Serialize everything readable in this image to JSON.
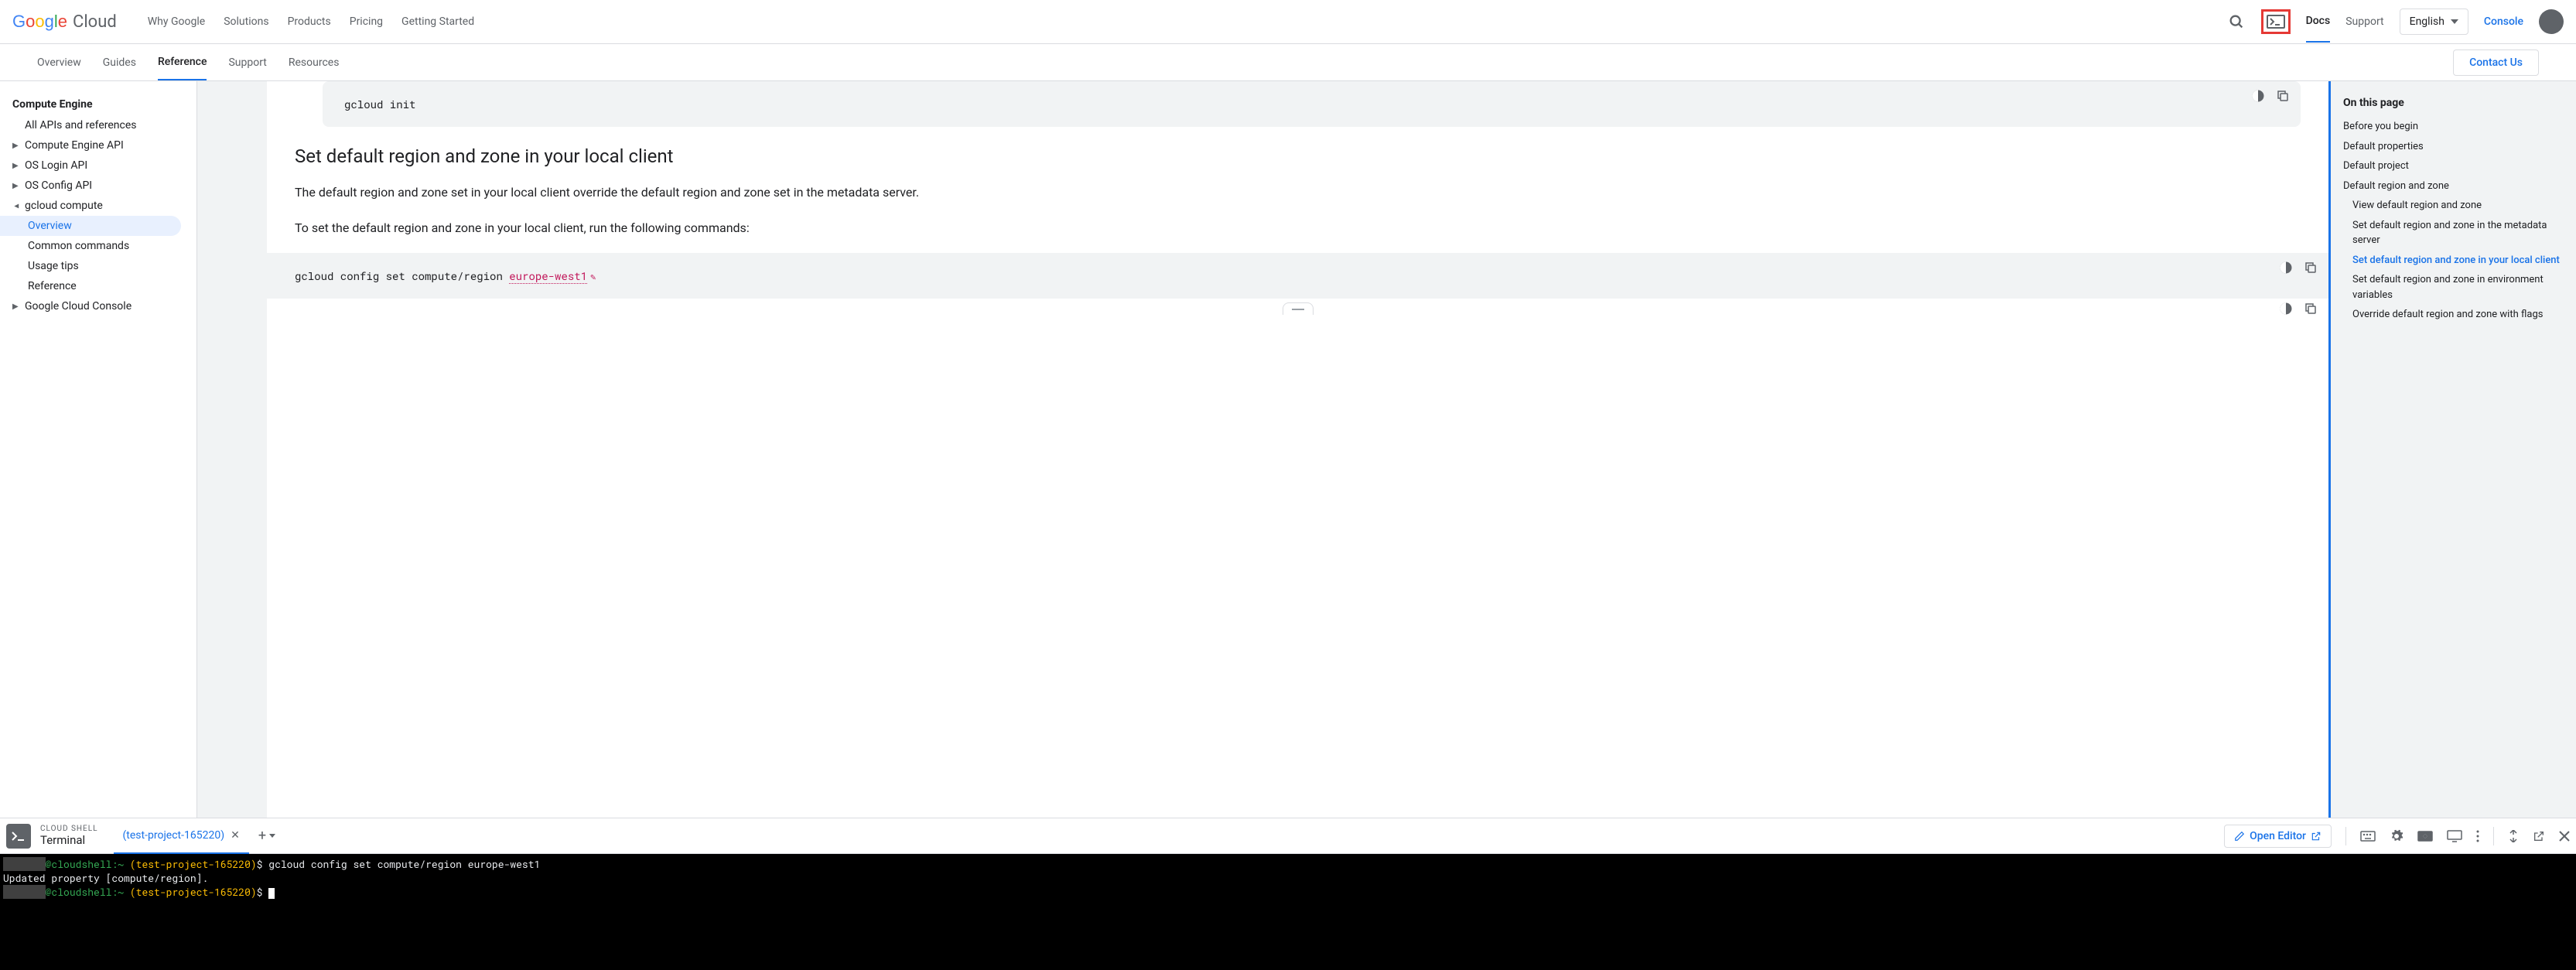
{
  "header": {
    "logo_suffix": "Cloud",
    "nav": [
      "Why Google",
      "Solutions",
      "Products",
      "Pricing",
      "Getting Started"
    ],
    "docs": "Docs",
    "support": "Support",
    "language": "English",
    "console": "Console"
  },
  "subnav": {
    "items": [
      "Overview",
      "Guides",
      "Reference",
      "Support",
      "Resources"
    ],
    "active_index": 2,
    "contact": "Contact Us"
  },
  "sidebar": {
    "heading": "Compute Engine",
    "items": [
      {
        "label": "All APIs and references",
        "indent": 1,
        "arrow": false
      },
      {
        "label": "Compute Engine API",
        "indent": 1,
        "arrow": true
      },
      {
        "label": "OS Login API",
        "indent": 1,
        "arrow": true
      },
      {
        "label": "OS Config API",
        "indent": 1,
        "arrow": true
      },
      {
        "label": "gcloud compute",
        "indent": 1,
        "arrow": true,
        "expanded": true
      },
      {
        "label": "Overview",
        "indent": 2,
        "arrow": false,
        "active": true
      },
      {
        "label": "Common commands",
        "indent": 2,
        "arrow": false
      },
      {
        "label": "Usage tips",
        "indent": 2,
        "arrow": false
      },
      {
        "label": "Reference",
        "indent": 2,
        "arrow": false
      },
      {
        "label": "Google Cloud Console",
        "indent": 1,
        "arrow": true
      }
    ]
  },
  "content": {
    "code1": "gcloud init",
    "heading": "Set default region and zone in your local client",
    "para1": "The default region and zone set in your local client override the default region and zone set in the metadata server.",
    "para2": "To set the default region and zone in your local client, run the following commands:",
    "code2_prefix": "gcloud config set compute/region ",
    "code2_var": "europe-west1"
  },
  "toc": {
    "heading": "On this page",
    "items": [
      {
        "label": "Before you begin"
      },
      {
        "label": "Default properties"
      },
      {
        "label": "Default project"
      },
      {
        "label": "Default region and zone"
      },
      {
        "label": "View default region and zone",
        "indent": true
      },
      {
        "label": "Set default region and zone in the metadata server",
        "indent": true
      },
      {
        "label": "Set default region and zone in your local client",
        "indent": true,
        "active": true
      },
      {
        "label": "Set default region and zone in environment variables",
        "indent": true
      },
      {
        "label": "Override default region and zone with flags",
        "indent": true
      }
    ]
  },
  "shell": {
    "subtitle": "CLOUD SHELL",
    "title": "Terminal",
    "tab": "(test-project-165220)",
    "open_editor": "Open Editor",
    "lines": [
      {
        "redact": "       ",
        "user": "@cloudshell",
        "host": ":~ ",
        "project": "(test-project-165220)",
        "prompt": "$ ",
        "cmd": "gcloud config set compute/region europe-west1"
      },
      {
        "plain": "Updated property [compute/region]."
      },
      {
        "redact": "       ",
        "user": "@cloudshell",
        "host": ":~ ",
        "project": "(test-project-165220)",
        "prompt": "$ ",
        "cursor": true
      }
    ]
  }
}
